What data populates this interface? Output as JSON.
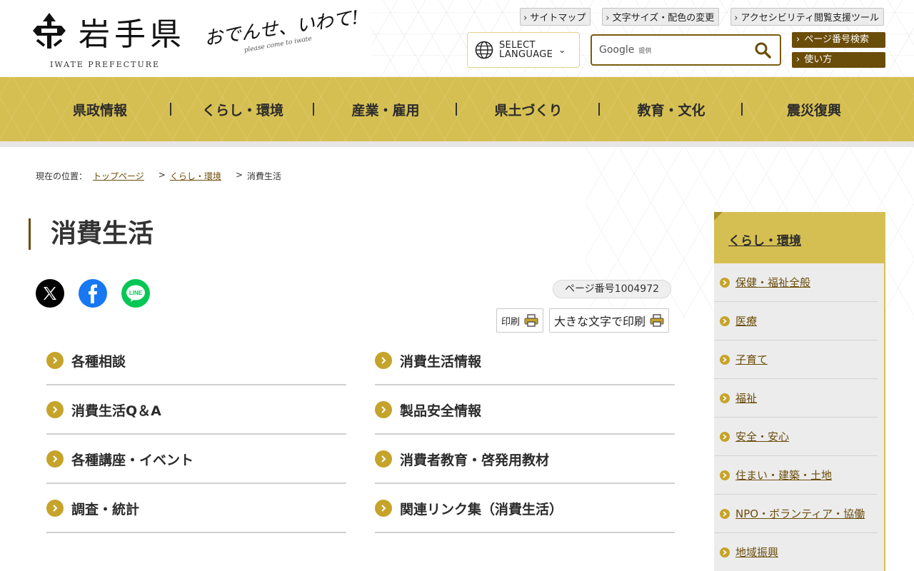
{
  "header": {
    "logo_text": "岩手県",
    "logo_sub": "IWATE PREFECTURE",
    "tagline": "おでんせ、いわて!",
    "tagline_sub": "please come to iwate",
    "util_links": [
      "サイトマップ",
      "文字サイズ・配色の変更",
      "アクセシビリティ閲覧支援ツール"
    ],
    "language": "SELECT\nLANGUAGE",
    "language_line1": "SELECT",
    "language_line2": "LANGUAGE",
    "search": {
      "brand": "Google",
      "brand_sub": "提供",
      "value": ""
    },
    "page_number_search": "ページ番号検索",
    "how_to_use": "使い方"
  },
  "nav": [
    "県政情報",
    "くらし・環境",
    "産業・雇用",
    "県土づくり",
    "教育・文化",
    "震災復興"
  ],
  "breadcrumb": {
    "label": "現在の位置：",
    "items": [
      "トップページ",
      "くらし・環境"
    ],
    "current": "消費生活"
  },
  "page": {
    "title": "消費生活",
    "page_number": "ページ番号1004972",
    "print": "印刷",
    "print_large": "大きな文字で印刷"
  },
  "social": [
    "x-icon",
    "facebook-icon",
    "line-icon"
  ],
  "social_line_text": "LINE",
  "links": [
    "各種相談",
    "消費生活情報",
    "消費生活Q＆A",
    "製品安全情報",
    "各種講座・イベント",
    "消費者教育・啓発用教材",
    "調査・統計",
    "関連リンク集（消費生活）"
  ],
  "sidebar": {
    "heading": "くらし・環境",
    "items": [
      "保健・福祉全般",
      "医療",
      "子育て",
      "福祉",
      "安全・安心",
      "住まい・建築・土地",
      "NPO・ボランティア・協働",
      "地域振興"
    ]
  },
  "colors": {
    "accent": "#d6bf52",
    "brown": "#6b4d0a",
    "icon_gold": "#c6a32a"
  }
}
